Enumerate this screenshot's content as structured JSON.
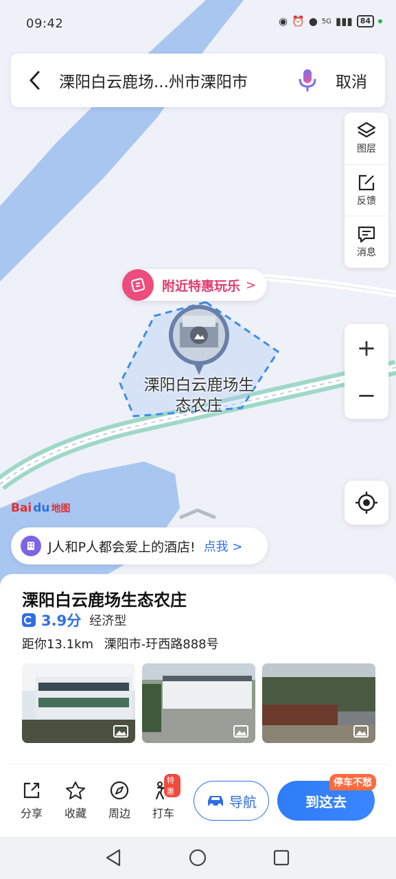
{
  "status_bar": {
    "time": "09:42",
    "battery": "84",
    "network": "5G"
  },
  "search": {
    "query": "溧阳白云鹿场...州市溧阳市",
    "cancel_label": "取消"
  },
  "map_tools": [
    {
      "label": "图层",
      "icon": "layers-icon"
    },
    {
      "label": "反馈",
      "icon": "feedback-icon"
    },
    {
      "label": "消息",
      "icon": "message-icon"
    }
  ],
  "zoom": {
    "in": "+",
    "out": "−"
  },
  "promo": {
    "label": "附近特惠玩乐",
    "arrow": ">"
  },
  "poi_marker": {
    "label": "溧阳白云鹿场生态农庄"
  },
  "logo": {
    "text": "Bai",
    "paw": "du",
    "suffix": "地图"
  },
  "ad_banner": {
    "text": "J人和P人都会爱上的酒店!",
    "link": "点我 >"
  },
  "poi_card": {
    "title": "溧阳白云鹿场生态农庄",
    "rating": "3.9分",
    "type": "经济型",
    "distance": "距你13.1km",
    "address": "溧阳市-玗西路888号"
  },
  "actions": [
    {
      "label": "分享",
      "icon": "share-icon"
    },
    {
      "label": "收藏",
      "icon": "star-icon"
    },
    {
      "label": "周边",
      "icon": "compass-icon"
    },
    {
      "label": "打车",
      "icon": "taxi-icon",
      "badge": "特惠"
    }
  ],
  "nav_button": {
    "label": "导航"
  },
  "go_button": {
    "label": "到这去",
    "tag": "停车不愁"
  },
  "colors": {
    "accent": "#2f6fe0",
    "promo": "#e23b6c",
    "water": "#a8c6f0"
  }
}
